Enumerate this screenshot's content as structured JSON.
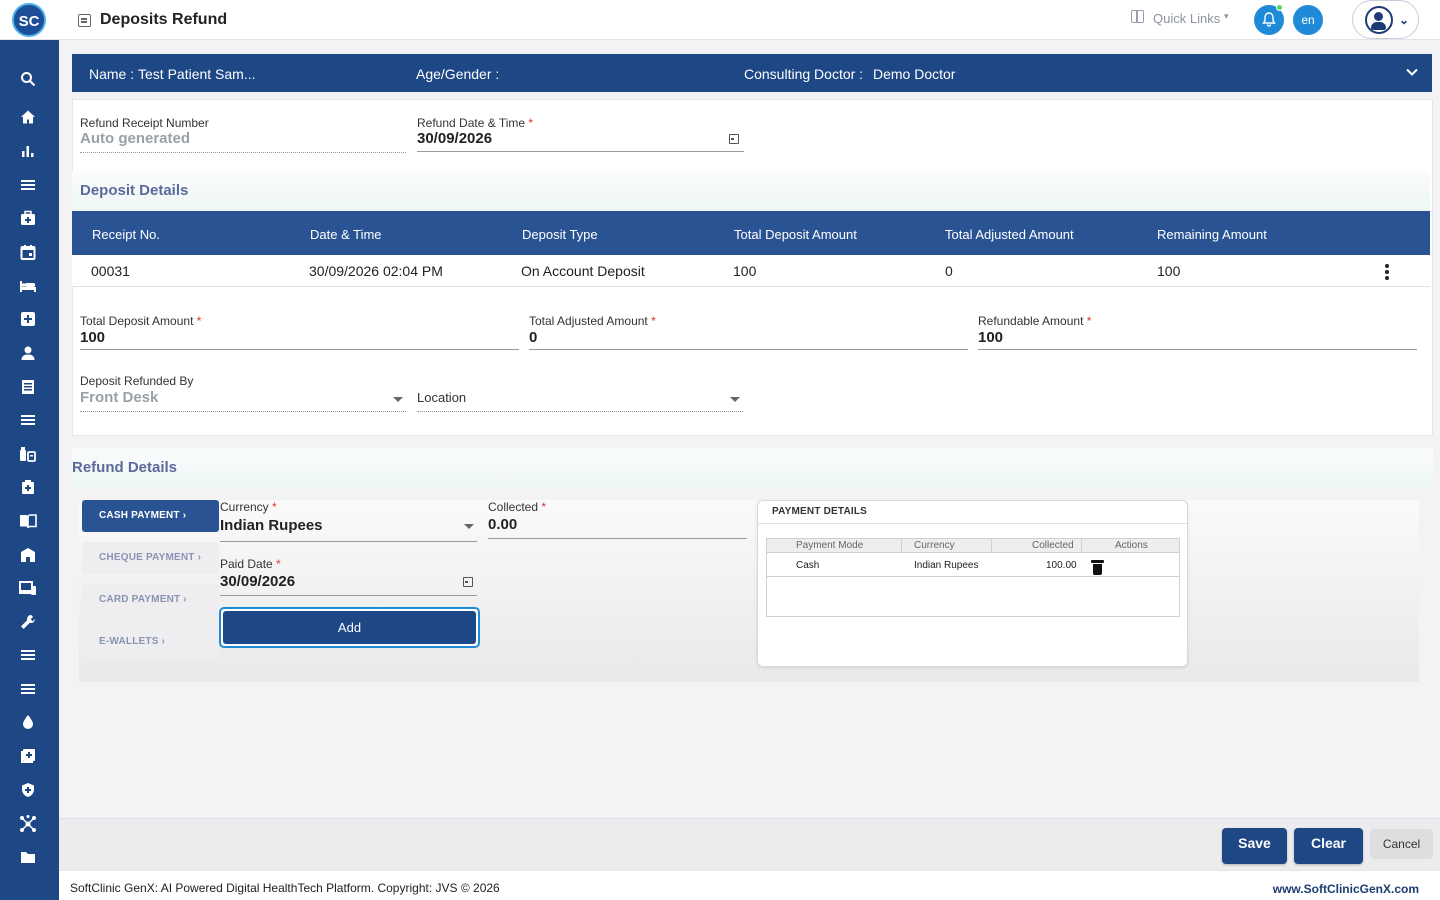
{
  "app": {
    "logo_text": "SC",
    "page_title": "Deposits Refund"
  },
  "header": {
    "quick_links": "Quick Links",
    "language": "en",
    "accent": "#1f8bd8",
    "brand": "#1d4785"
  },
  "patient": {
    "name_label": "Name :",
    "name_value": "Test Patient Sam...",
    "age_gender_label": "Age/Gender :",
    "doctor_label": "Consulting Doctor :",
    "doctor_value": "Demo Doctor"
  },
  "receipt": {
    "number_label": "Refund Receipt Number",
    "number_value": "Auto generated",
    "date_label": "Refund Date & Time",
    "date_value": "30/09/2026"
  },
  "deposit_details": {
    "title": "Deposit Details",
    "columns": [
      "Receipt No.",
      "Date & Time",
      "Deposit Type",
      "Total Deposit Amount",
      "Total Adjusted Amount",
      "Remaining Amount"
    ],
    "rows": [
      [
        "00031",
        "30/09/2026 02:04 PM",
        "On Account Deposit",
        "100",
        "0",
        "100"
      ]
    ]
  },
  "totals": {
    "deposit_label": "Total Deposit Amount",
    "deposit_value": "100",
    "adjusted_label": "Total Adjusted Amount",
    "adjusted_value": "0",
    "refundable_label": "Refundable Amount",
    "refundable_value": "100"
  },
  "refunded_by": {
    "label": "Deposit Refunded By",
    "value": "Front Desk",
    "location_placeholder": "Location"
  },
  "refund_details": {
    "title": "Refund Details",
    "tabs": [
      "CASH PAYMENT ›",
      "CHEQUE PAYMENT ›",
      "CARD PAYMENT ›",
      "E-WALLETS ›"
    ],
    "currency_label": "Currency",
    "currency_value": "Indian Rupees",
    "collected_label": "Collected",
    "collected_value": "0.00",
    "paid_date_label": "Paid Date",
    "paid_date_value": "30/09/2026",
    "add_label": "Add"
  },
  "payment_details": {
    "title": "PAYMENT DETAILS",
    "columns": [
      "Payment Mode",
      "Currency",
      "Collected",
      "Actions"
    ],
    "rows": [
      [
        "Cash",
        "Indian Rupees",
        "100.00"
      ]
    ]
  },
  "actions": {
    "save": "Save",
    "clear": "Clear",
    "cancel": "Cancel"
  },
  "footer": {
    "copyright": "SoftClinic GenX: AI Powered Digital HealthTech Platform. Copyright: JVS © 2026",
    "site": "www.SoftClinicGenX.com"
  },
  "sidebar_icons": [
    "search-icon",
    "home-icon",
    "bar-chart-icon",
    "menu-icon",
    "doctor-bag-icon",
    "calendar-icon",
    "bed-icon",
    "plus-box-icon",
    "person-icon",
    "report-icon",
    "list-icon",
    "medicine-icon",
    "first-aid-icon",
    "book-icon",
    "store-icon",
    "devices-icon",
    "wrench-icon",
    "menu-alt-icon",
    "menu-alt2-icon",
    "drop-icon",
    "add-box-icon",
    "shield-icon",
    "network-icon",
    "folder-icon"
  ]
}
